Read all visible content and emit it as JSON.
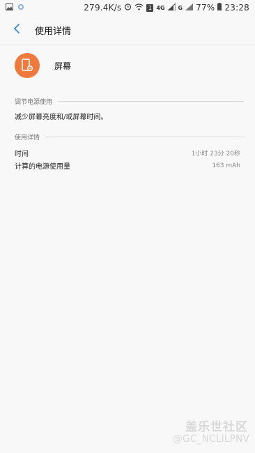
{
  "status_bar": {
    "network_speed": "279.4K/s",
    "lte_label": "4G",
    "g_label": "G",
    "sim_number": "1",
    "battery": "77%",
    "time": "23:28"
  },
  "header": {
    "title": "使用详情"
  },
  "app": {
    "name": "屏幕",
    "icon": "screen-settings-icon"
  },
  "adjust_section": {
    "label": "调节电源使用",
    "tip": "减少屏幕亮度和/或屏幕时间。"
  },
  "details_section": {
    "label": "使用详情",
    "rows": [
      {
        "label": "时间",
        "value": "1小时 23分 20秒"
      },
      {
        "label": "计算的电源使用量",
        "value": "163 mAh"
      }
    ]
  },
  "watermark": {
    "logo": "盖乐世社区",
    "user": "@GC_NCLILPNV"
  },
  "colors": {
    "accent": "#ef7a3d",
    "back_arrow": "#3b8fd0"
  }
}
